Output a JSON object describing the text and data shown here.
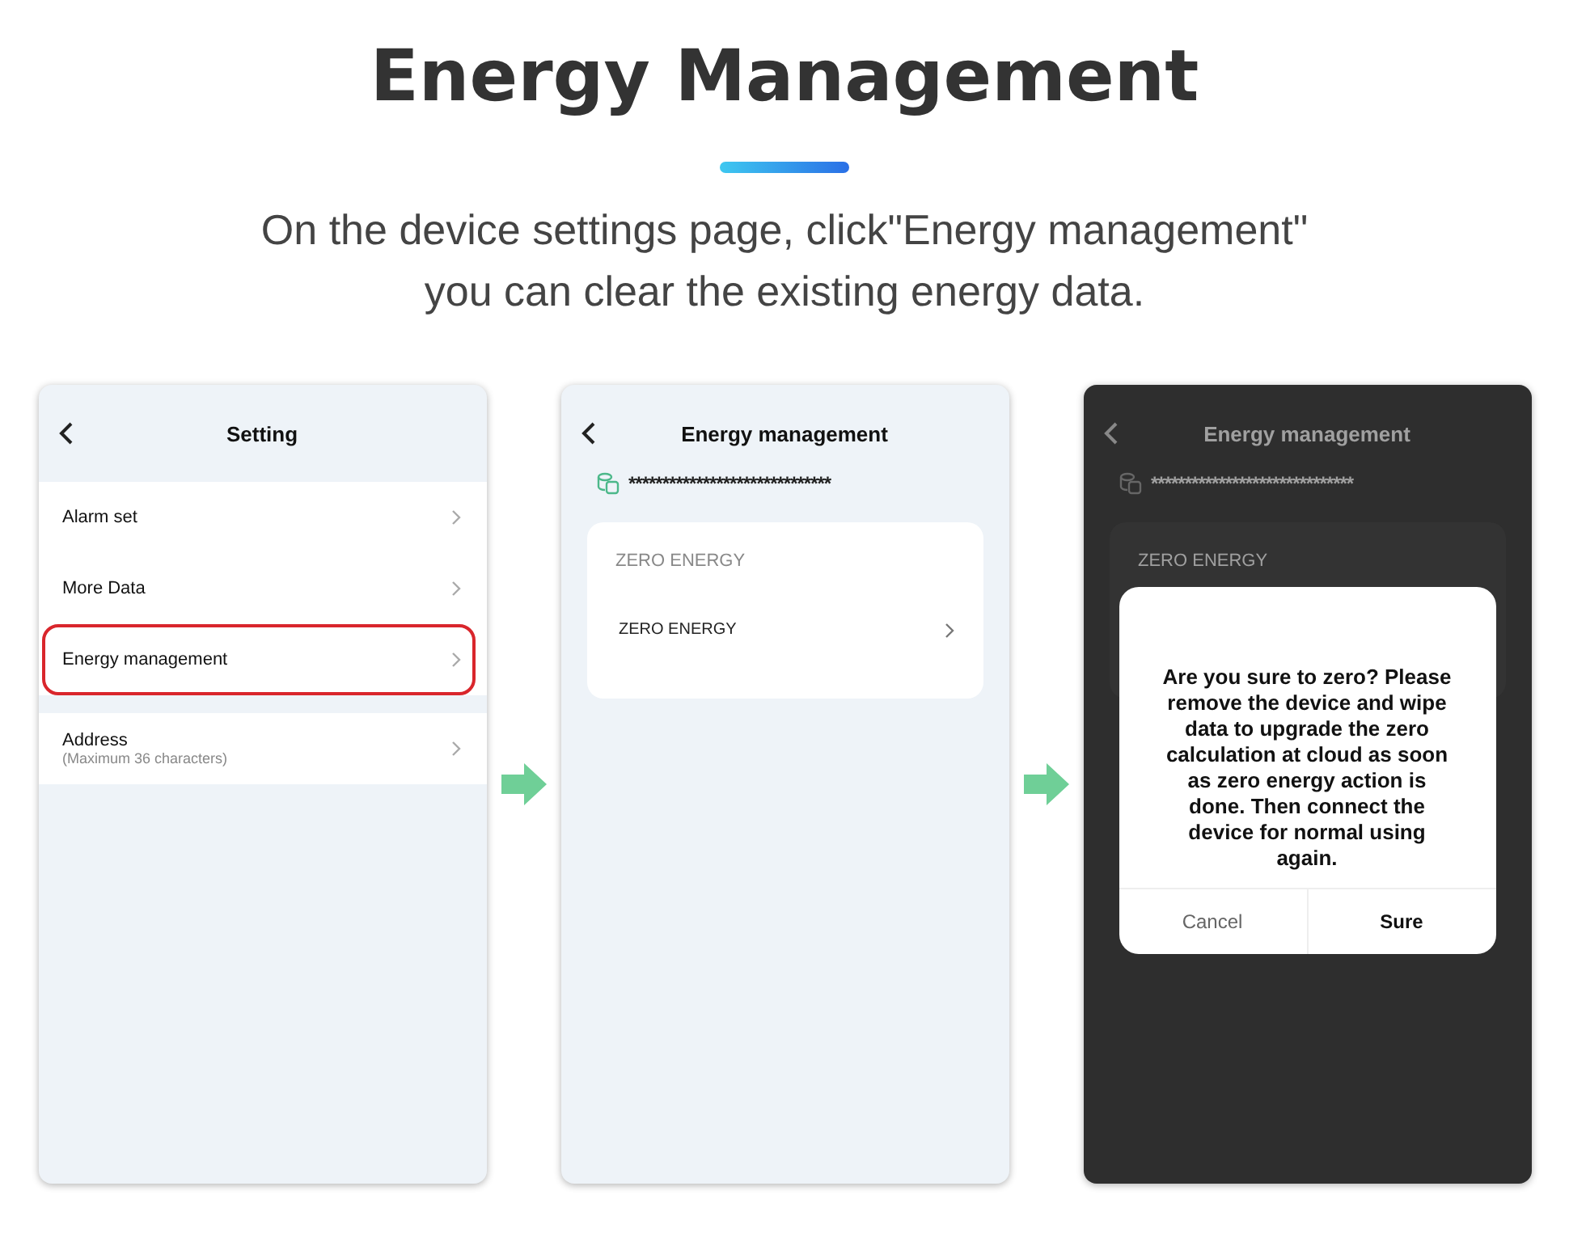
{
  "title": "Energy Management",
  "subtitle": [
    "On the device settings page, click\"Energy management\"",
    "you can clear the existing energy data."
  ],
  "screens": [
    {
      "kind": "settings",
      "title": "Setting",
      "dimmed": false,
      "groups": [
        [
          {
            "label": "Alarm set",
            "highlighted": false
          },
          {
            "label": "More Data",
            "highlighted": false
          },
          {
            "label": "Energy management",
            "highlighted": true
          }
        ],
        [
          {
            "label": "Address",
            "sub": "(Maximum 36 characters)",
            "highlighted": false
          }
        ]
      ]
    },
    {
      "kind": "energy",
      "title": "Energy management",
      "dimmed": false,
      "device_id": "******************************",
      "section": "ZERO ENERGY",
      "row": "ZERO ENERGY"
    },
    {
      "kind": "energy",
      "title": "Energy management",
      "dimmed": true,
      "device_id": "******************************",
      "section": "ZERO ENERGY",
      "dialog": {
        "message": "Are you sure to zero? Please remove the device and wipe data to upgrade the zero calculation at cloud as soon as zero energy action is done. Then connect the device for normal using again.",
        "cancel": "Cancel",
        "confirm": "Sure"
      }
    }
  ]
}
